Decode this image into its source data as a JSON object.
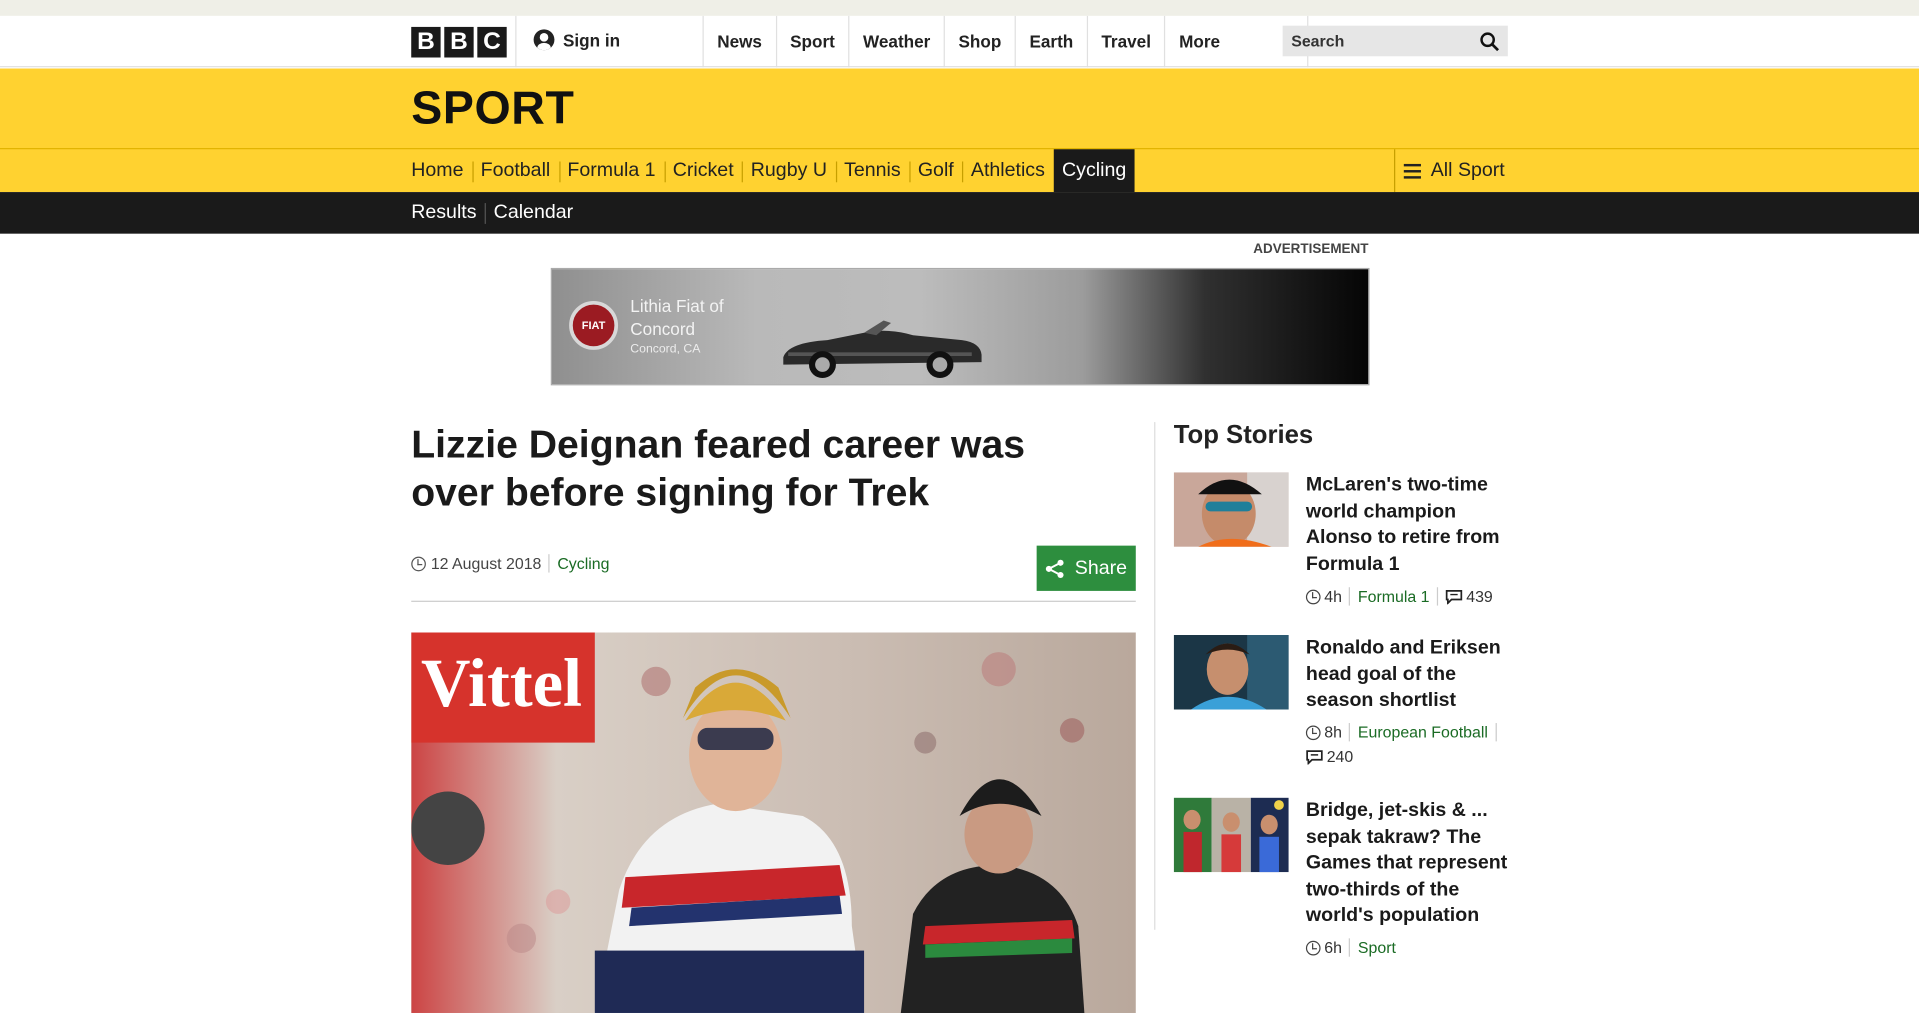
{
  "header": {
    "logo": [
      "B",
      "B",
      "C"
    ],
    "signin_label": "Sign in",
    "nav": [
      "News",
      "Sport",
      "Weather",
      "Shop",
      "Earth",
      "Travel"
    ],
    "more_label": "More",
    "search_placeholder": "Search"
  },
  "sport": {
    "title": "SPORT",
    "nav": [
      "Home",
      "Football",
      "Formula 1",
      "Cricket",
      "Rugby U",
      "Tennis",
      "Golf",
      "Athletics",
      "Cycling"
    ],
    "active": "Cycling",
    "all_sport_label": "All Sport",
    "subnav": [
      "Results",
      "Calendar"
    ]
  },
  "ad": {
    "label": "ADVERTISEMENT",
    "logo_text": "FIAT",
    "line1": "Lithia Fiat of",
    "line2": "Concord",
    "line3": "Concord, CA"
  },
  "article": {
    "headline": "Lizzie Deignan feared career was over before signing for Trek",
    "date": "12 August 2018",
    "topic": "Cycling",
    "share_label": "Share",
    "photo_text": "Vittel"
  },
  "top_stories": {
    "title": "Top Stories",
    "items": [
      {
        "title": "McLaren's two-time world champion Alonso to retire from Formula 1",
        "age": "4h",
        "topic": "Formula 1",
        "comments": "439"
      },
      {
        "title": "Ronaldo and Eriksen head goal of the season shortlist",
        "age": "8h",
        "topic": "European Football",
        "comments": "240"
      },
      {
        "title": "Bridge, jet-skis & ... sepak takraw? The Games that represent two-thirds of the world's population",
        "age": "6h",
        "topic": "Sport",
        "comments": ""
      }
    ]
  },
  "colors": {
    "sport_yellow": "#ffd230",
    "nav_black": "#1a1a1a",
    "share_green": "#2d8e3e",
    "topic_green": "#1a6b24"
  }
}
